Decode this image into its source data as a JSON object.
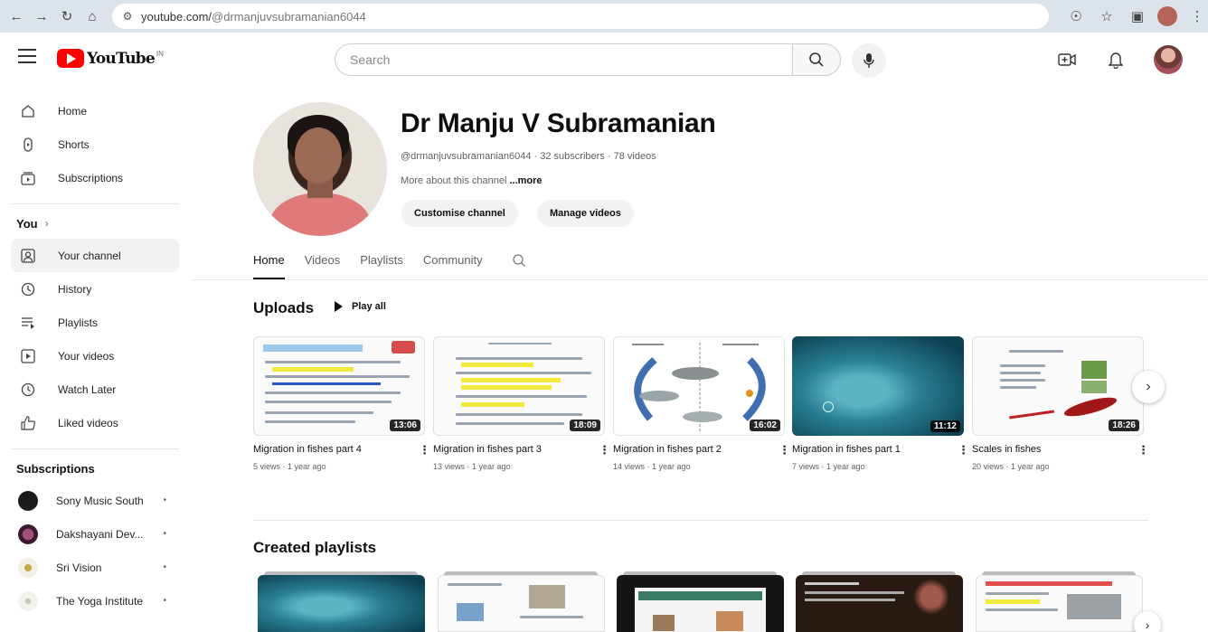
{
  "browser": {
    "url_domain": "youtube.com/",
    "url_path": "@drmanjuvsubramanian6044"
  },
  "header": {
    "logo_text": "YouTube",
    "logo_region": "IN",
    "search_placeholder": "Search"
  },
  "sidebar": {
    "main": [
      {
        "label": "Home",
        "icon": "home-icon"
      },
      {
        "label": "Shorts",
        "icon": "shorts-icon"
      },
      {
        "label": "Subscriptions",
        "icon": "subscriptions-icon"
      }
    ],
    "you_heading": "You",
    "you_items": [
      {
        "label": "Your channel",
        "icon": "your-channel-icon"
      },
      {
        "label": "History",
        "icon": "history-icon"
      },
      {
        "label": "Playlists",
        "icon": "playlists-icon"
      },
      {
        "label": "Your videos",
        "icon": "your-videos-icon"
      },
      {
        "label": "Watch Later",
        "icon": "watch-later-icon"
      },
      {
        "label": "Liked videos",
        "icon": "liked-videos-icon"
      }
    ],
    "subs_heading": "Subscriptions",
    "subscriptions": [
      {
        "label": "Sony Music South",
        "color": "#1a1a1a"
      },
      {
        "label": "Dakshayani Dev...",
        "color": "#5a2a4a"
      },
      {
        "label": "Sri Vision",
        "color": "#f0e8d8"
      },
      {
        "label": "The Yoga Institute",
        "color": "#e8e8e0"
      }
    ]
  },
  "channel": {
    "name": "Dr Manju V Subramanian",
    "handle": "@drmanjuvsubramanian6044",
    "subscribers": "32 subscribers",
    "videos": "78 videos",
    "about": "More about this channel",
    "about_more": "...more",
    "customise_label": "Customise channel",
    "manage_label": "Manage videos"
  },
  "tabs": [
    "Home",
    "Videos",
    "Playlists",
    "Community"
  ],
  "uploads": {
    "title": "Uploads",
    "play_all": "Play all",
    "videos": [
      {
        "title": "Migration in fishes part 4",
        "meta": "5 views · 1 year ago",
        "duration": "13:06"
      },
      {
        "title": "Migration in fishes part 3",
        "meta": "13 views · 1 year ago",
        "duration": "18:09"
      },
      {
        "title": "Migration in fishes part 2",
        "meta": "14 views · 1 year ago",
        "duration": "16:02"
      },
      {
        "title": "Migration in fishes part 1",
        "meta": "7 views · 1 year ago",
        "duration": "11:12"
      },
      {
        "title": "Scales in fishes",
        "meta": "20 views · 1 year ago",
        "duration": "18:26"
      }
    ]
  },
  "playlists": {
    "title": "Created playlists"
  }
}
